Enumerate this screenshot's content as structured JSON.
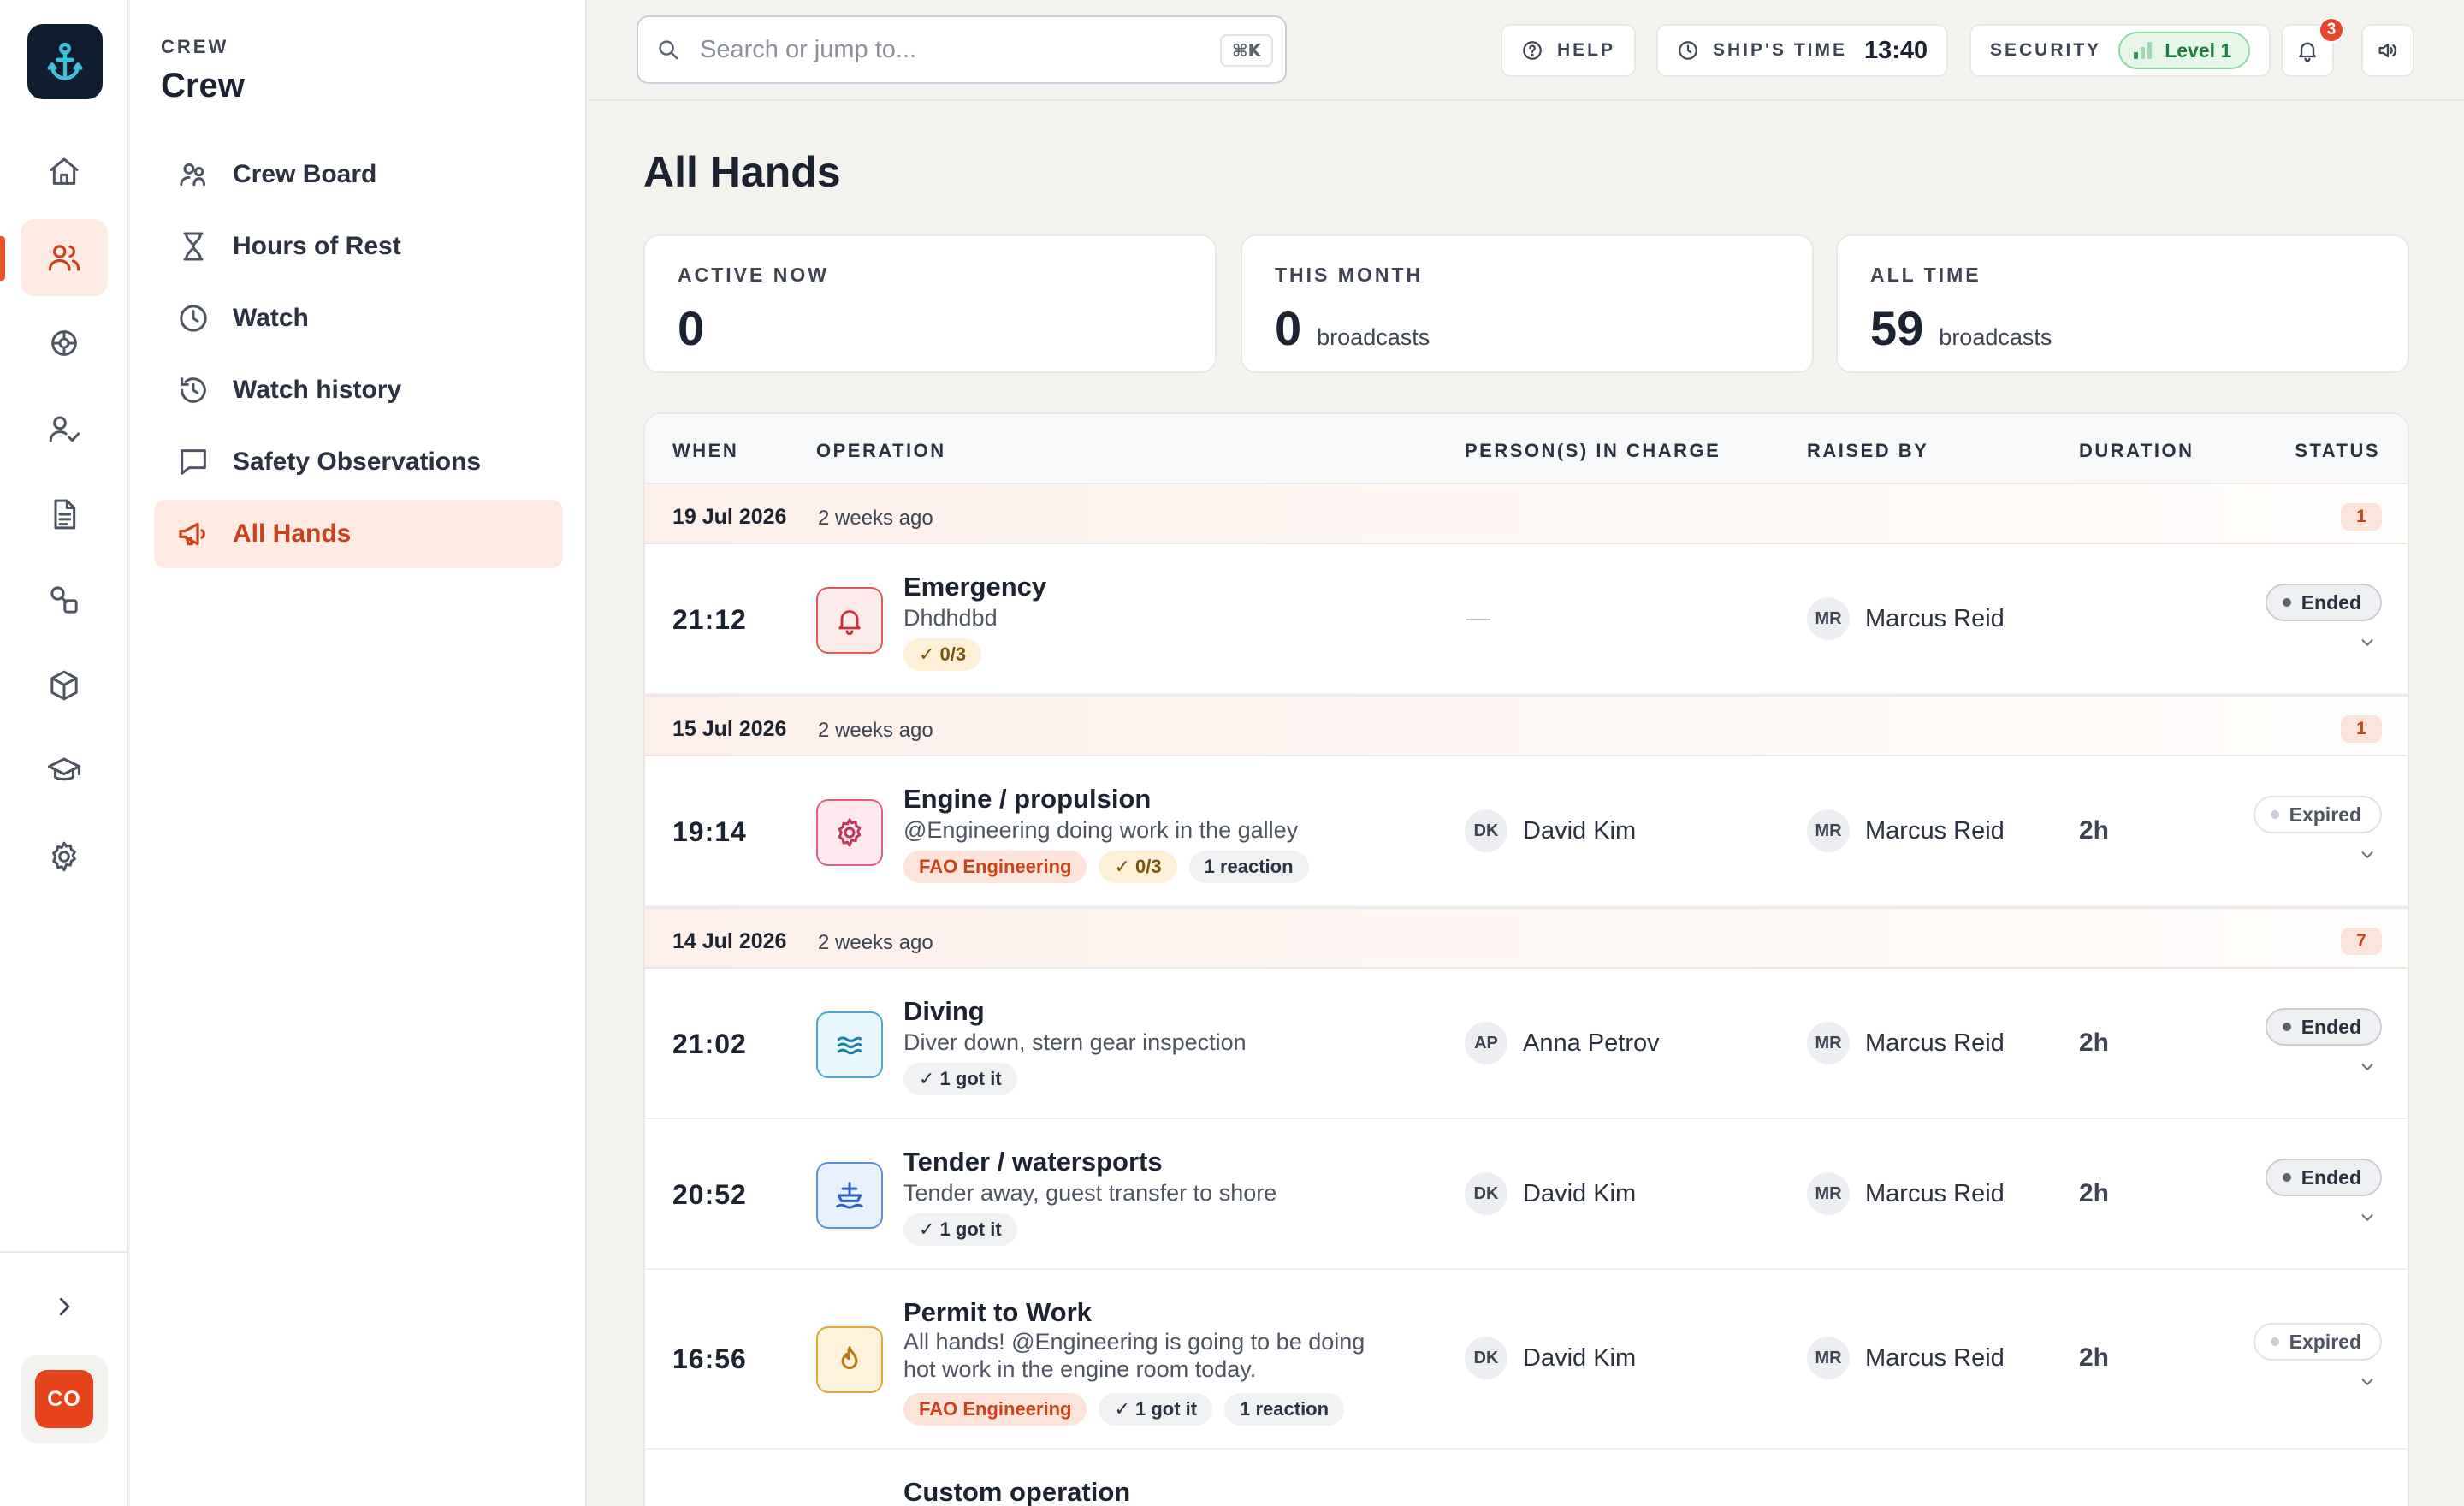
{
  "rail": {
    "avatar_initials": "CO",
    "items": [
      "home-icon",
      "crew-icon",
      "helm-icon",
      "user-check-icon",
      "document-icon",
      "shapes-icon",
      "box-icon",
      "graduation-cap-icon",
      "settings-icon"
    ]
  },
  "subnav": {
    "eyebrow": "CREW",
    "title": "Crew",
    "items": [
      {
        "label": "Crew Board",
        "icon": "people-icon"
      },
      {
        "label": "Hours of Rest",
        "icon": "hourglass-icon"
      },
      {
        "label": "Watch",
        "icon": "clock-icon"
      },
      {
        "label": "Watch history",
        "icon": "history-icon"
      },
      {
        "label": "Safety Observations",
        "icon": "comment-icon"
      },
      {
        "label": "All Hands",
        "icon": "megaphone-icon",
        "active": true
      }
    ]
  },
  "topbar": {
    "search_placeholder": "Search or jump to...",
    "search_shortcut": "⌘K",
    "help_label": "HELP",
    "ships_time_label": "SHIP'S TIME",
    "ships_time_value": "13:40",
    "security_label": "SECURITY",
    "security_level": "Level 1",
    "notifications_count": "3"
  },
  "page": {
    "title": "All Hands"
  },
  "stats": [
    {
      "label": "ACTIVE NOW",
      "value": "0",
      "suffix": ""
    },
    {
      "label": "THIS MONTH",
      "value": "0",
      "suffix": "broadcasts"
    },
    {
      "label": "ALL TIME",
      "value": "59",
      "suffix": "broadcasts"
    }
  ],
  "table": {
    "headers": {
      "when": "WHEN",
      "operation": "OPERATION",
      "persons": "PERSON(S) IN CHARGE",
      "raised_by": "RAISED BY",
      "duration": "DURATION",
      "status": "STATUS"
    },
    "groups": [
      {
        "date": "19 Jul 2026",
        "ago": "2 weeks ago",
        "count": "1"
      },
      {
        "date": "15 Jul 2026",
        "ago": "2 weeks ago",
        "count": "1"
      },
      {
        "date": "14 Jul 2026",
        "ago": "2 weeks ago",
        "count": "7"
      }
    ],
    "rows": [
      {
        "time": "21:12",
        "name": "Emergency",
        "desc": "Dhdhdbd",
        "ack": "✓ 0/3",
        "person_in_charge": "—",
        "raised_initials": "MR",
        "raised_by": "Marcus Reid",
        "status": "Ended"
      },
      {
        "time": "19:14",
        "name": "Engine / propulsion",
        "desc": "@Engineering doing work in the galley",
        "fao": "FAO Engineering",
        "ack": "✓ 0/3",
        "reactions": "1 reaction",
        "pic_initials": "DK",
        "person_in_charge": "David Kim",
        "raised_initials": "MR",
        "raised_by": "Marcus Reid",
        "duration": "2h",
        "status": "Expired"
      },
      {
        "time": "21:02",
        "name": "Diving",
        "desc": "Diver down, stern gear inspection",
        "got": "✓ 1 got it",
        "pic_initials": "AP",
        "person_in_charge": "Anna Petrov",
        "raised_initials": "MR",
        "raised_by": "Marcus Reid",
        "duration": "2h",
        "status": "Ended"
      },
      {
        "time": "20:52",
        "name": "Tender / watersports",
        "desc": "Tender away, guest transfer to shore",
        "got": "✓ 1 got it",
        "pic_initials": "DK",
        "person_in_charge": "David Kim",
        "raised_initials": "MR",
        "raised_by": "Marcus Reid",
        "duration": "2h",
        "status": "Ended"
      },
      {
        "time": "16:56",
        "name": "Permit to Work",
        "desc_line1": "All hands! @Engineering is going to be doing",
        "desc_line2": "hot work in the engine room today.",
        "fao": "FAO Engineering",
        "got": "✓ 1 got it",
        "reactions": "1 reaction",
        "pic_initials": "DK",
        "person_in_charge": "David Kim",
        "raised_initials": "MR",
        "raised_by": "Marcus Reid",
        "duration": "2h",
        "status": "Expired"
      },
      {
        "name": "Custom operation"
      }
    ]
  }
}
